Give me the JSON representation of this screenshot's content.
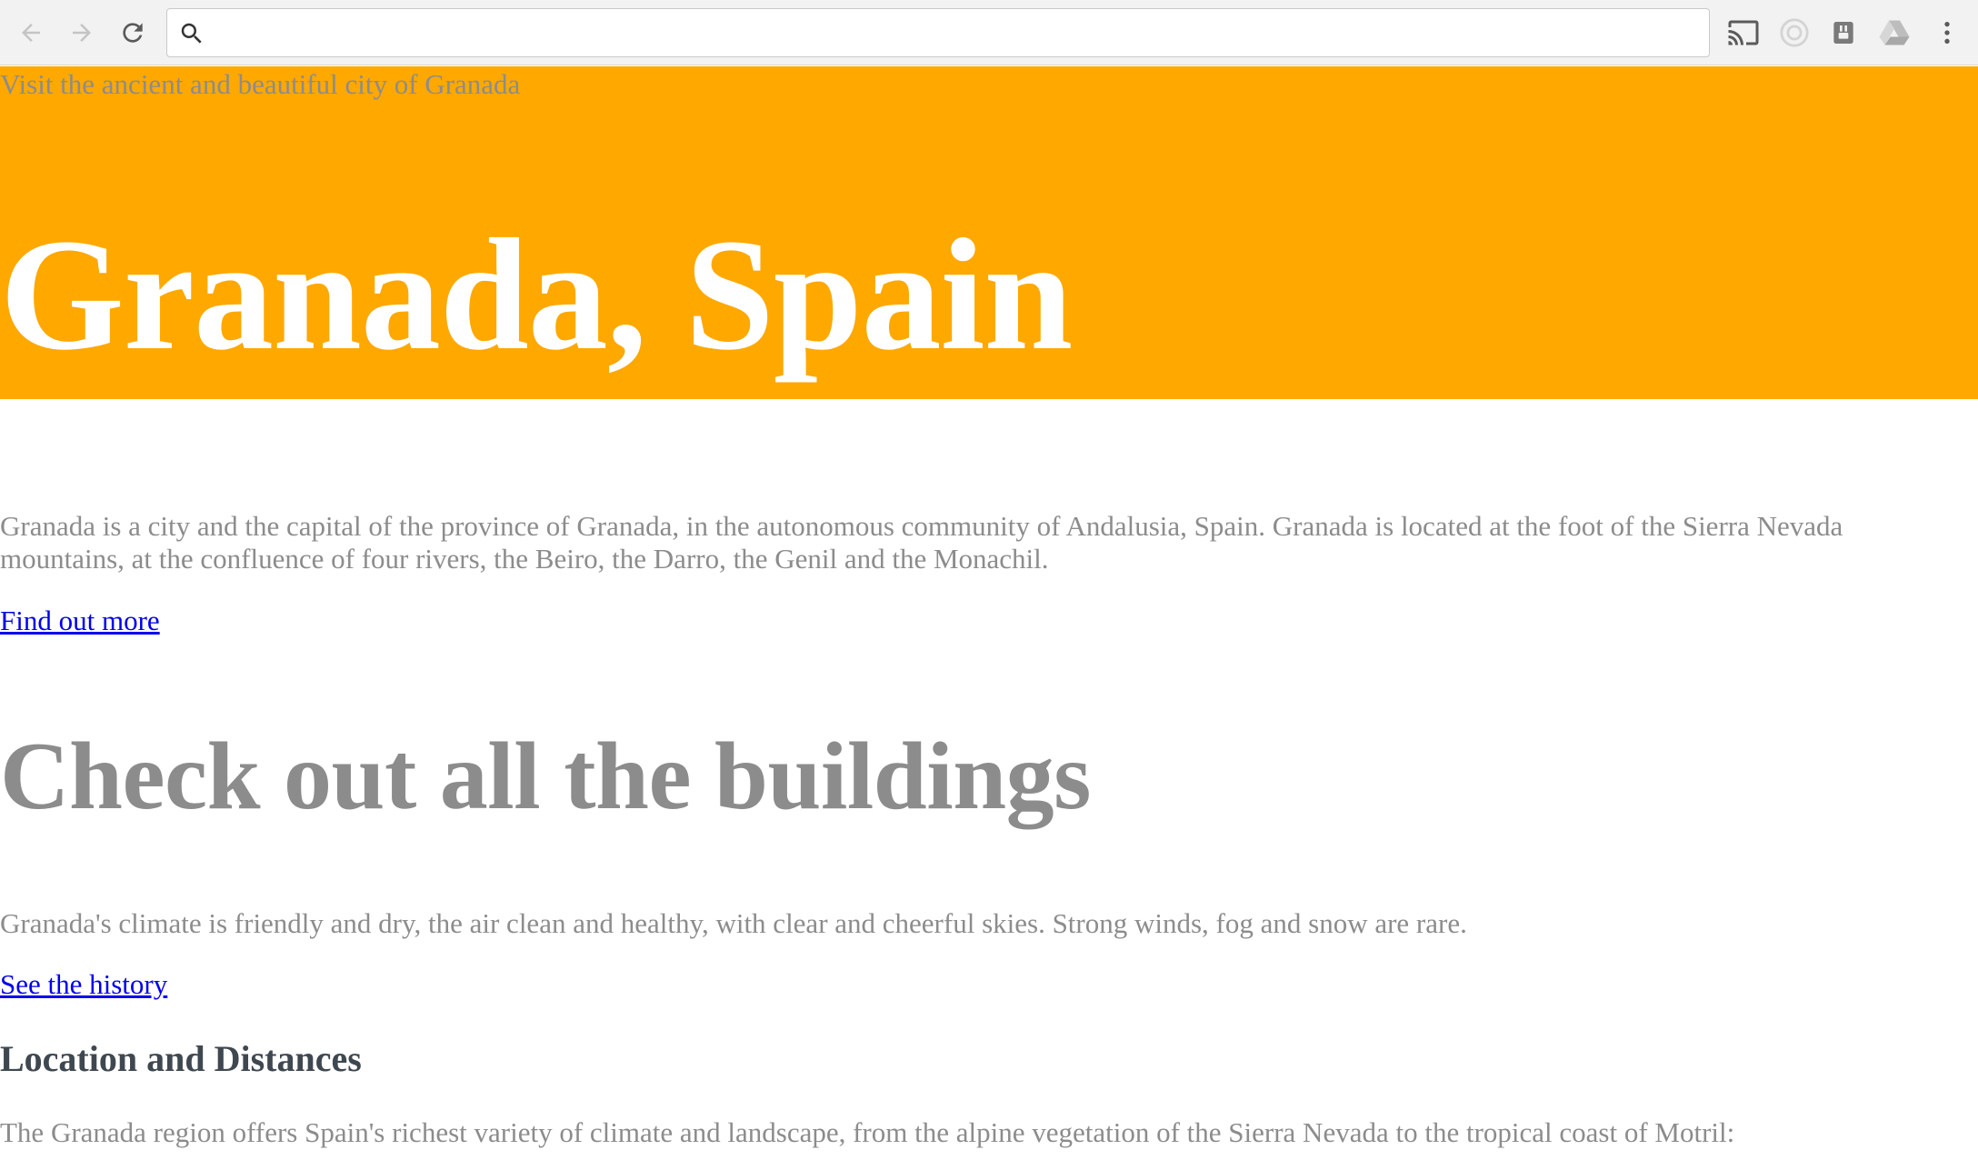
{
  "browser": {
    "address_value": "",
    "address_placeholder": ""
  },
  "page": {
    "tagline": "Visit the ancient and beautiful city of Granada",
    "hero_title": "Granada, Spain",
    "intro_paragraph": "Granada is a city and the capital of the province of Granada, in the autonomous community of Andalusia, Spain. Granada is located at the foot of the Sierra Nevada mountains, at the confluence of four rivers, the Beiro, the Darro, the Genil and the Monachil.",
    "link_find_out_more": "Find out more",
    "section_title": "Check out all the buildings",
    "climate_paragraph": "Granada's climate is friendly and dry, the air clean and healthy, with clear and cheerful skies. Strong winds, fog and snow are rare.",
    "link_history": "See the history",
    "sub_heading": "Location and Distances",
    "region_paragraph": "The Granada region offers Spain's richest variety of climate and landscape, from the alpine vegetation of the Sierra Nevada to the tropical coast of Motril:"
  },
  "colors": {
    "hero_background": "#ffa800",
    "body_text": "#8c8c8c",
    "link": "#0000ee",
    "sub_heading": "#3f4850"
  },
  "icons": {
    "back": "arrow-left-icon",
    "forward": "arrow-right-icon",
    "reload": "reload-icon",
    "search": "search-icon",
    "cast": "cast-icon",
    "extension_a": "extension-circle-icon",
    "extension_b": "extension-plug-icon",
    "drive": "drive-icon",
    "menu": "kebab-menu-icon"
  }
}
